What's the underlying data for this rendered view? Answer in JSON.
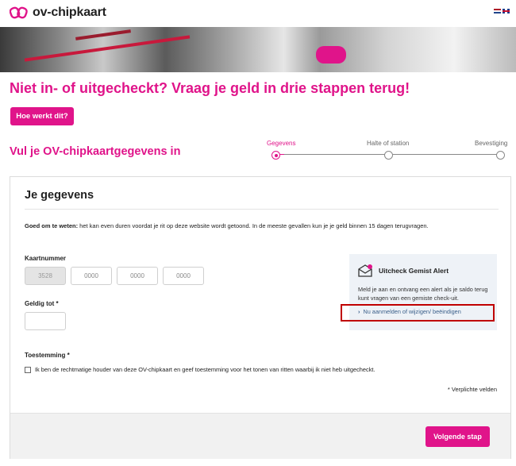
{
  "header": {
    "logo_text": "ov-chipkaart",
    "languages": [
      "nl-flag-icon",
      "en-flag-icon"
    ]
  },
  "hero": {
    "image": "ov-gate-photo"
  },
  "page_title": "Niet in- of uitgecheckt? Vraag je geld in drie stappen terug!",
  "how_button": "Hoe werkt dit?",
  "section_title": "Vul je OV-chipkaartgegevens in",
  "steps": [
    {
      "label": "Gegevens",
      "active": true
    },
    {
      "label": "Halte of station",
      "active": false
    },
    {
      "label": "Bevestiging",
      "active": false
    }
  ],
  "form": {
    "title": "Je gegevens",
    "notice_bold": "Goed om te weten:",
    "notice_text": " het kan even duren voordat je rit op deze website wordt getoond. In de meeste gevallen kun je je geld binnen 15 dagen terugvragen.",
    "card_number_label": "Kaartnummer",
    "card_number_parts": [
      "3528",
      "0000",
      "0000",
      "0000"
    ],
    "valid_until_label": "Geldig tot *",
    "valid_until_value": "",
    "consent_label": "Toestemming *",
    "consent_text": "Ik ben de rechtmatige houder van deze OV-chipkaart en geef toestemming voor het tonen van ritten waarbij ik niet heb uitgecheckt.",
    "required_note": "* Verplichte velden"
  },
  "alert": {
    "icon": "envelope-alert-icon",
    "title": "Uitcheck Gemist Alert",
    "text": "Meld je aan en ontvang een alert als je saldo terug kunt vragen van een gemiste check-uit.",
    "link": "Nu aanmelden of wijzigen/ beëindigen"
  },
  "next_button": "Volgende stap",
  "colors": {
    "brand": "#e0148a",
    "highlight": "#c00000",
    "alert_bg": "#eef2f7"
  }
}
